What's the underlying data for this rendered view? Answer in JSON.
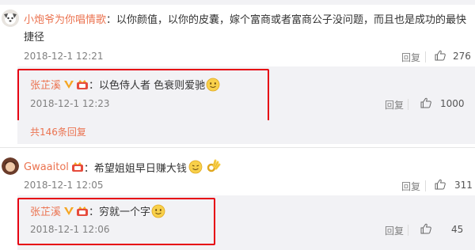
{
  "comments": [
    {
      "user": "小炮爷为你唱情歌",
      "text": "：以你颜值，以你的皮囊，嫁个富商或者富商公子没问题，而且也是成功的最快",
      "text_line2": "捷径",
      "time": "2018-12-1 12:21",
      "reply_label": "回复",
      "likes": "276",
      "replies": [
        {
          "user": "张芷溪",
          "text": "：以色侍人者 色衰则爱驰",
          "time": "2018-12-1 12:23",
          "reply_label": "回复",
          "likes": "1000"
        }
      ],
      "more_replies": "共146条回复"
    },
    {
      "user": "Gwaaitol",
      "text": "：希望姐姐早日赚大钱",
      "time": "2018-12-1 12:05",
      "reply_label": "回复",
      "likes": "311",
      "replies": [
        {
          "user": "张芷溪",
          "text": "：穷就一个字",
          "time": "2018-12-1 12:06",
          "reply_label": "回复",
          "likes": "45"
        }
      ]
    }
  ],
  "colors": {
    "username": "#eb7350",
    "highlight_box": "#e60012",
    "vip_badge": "#f5a623"
  },
  "icons": [
    "avatar",
    "vip-badge",
    "crown-badge",
    "smile-emoji",
    "thumbs-up-icon",
    "ok-hand-emoji"
  ]
}
